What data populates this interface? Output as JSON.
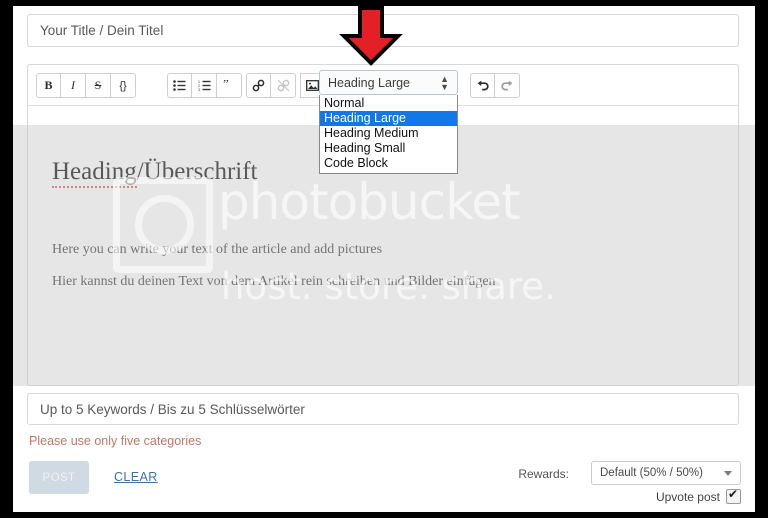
{
  "title_field": {
    "placeholder": "Your Title / Dein Titel",
    "value": ""
  },
  "toolbar": {
    "buttons": [
      {
        "name": "bold",
        "glyph": "B"
      },
      {
        "name": "italic",
        "glyph": "I"
      },
      {
        "name": "strikethrough",
        "glyph": "S"
      },
      {
        "name": "code",
        "glyph": "{}"
      },
      {
        "name": "bullet-list",
        "glyph": "☰"
      },
      {
        "name": "numbered-list",
        "glyph": "☲"
      },
      {
        "name": "blockquote",
        "glyph": "”"
      },
      {
        "name": "link",
        "glyph": "⚭"
      },
      {
        "name": "unlink",
        "glyph": "⚮"
      },
      {
        "name": "image",
        "glyph": "ὛC"
      },
      {
        "name": "undo",
        "glyph": "↶"
      },
      {
        "name": "redo",
        "glyph": "↷"
      }
    ],
    "format_select": {
      "selected": "Heading Large",
      "options": [
        "Normal",
        "Heading Large",
        "Heading Medium",
        "Heading Small",
        "Code Block"
      ],
      "highlight_color": "#1278e8"
    }
  },
  "editor": {
    "heading": "Heading/Überschrift",
    "heading_misspelled_part": "Heading",
    "heading_rest": "/Überschrift",
    "paragraphs": [
      "Here you can write your text of the article and add pictures",
      "Hier kannst du deinen Text von dem Artikel rein schreiben und Bilder einfügen"
    ]
  },
  "watermark": {
    "name": "photobucket",
    "tagline": "host. store. share.",
    "icon": "camera-icon"
  },
  "keywords_field": {
    "placeholder": "Up to 5 Keywords / Bis zu 5 Schlüsselwörter",
    "value": ""
  },
  "warning": {
    "text": "Please use only five categories",
    "color": "#c2766a"
  },
  "actions": {
    "post_label": "POST",
    "clear_label": "CLEAR"
  },
  "rewards": {
    "label": "Rewards:",
    "selected": "Default (50% / 50%)",
    "options": [
      "Default (50% / 50%)"
    ]
  },
  "upvote": {
    "label": "Upvote post",
    "checked": true
  },
  "annotation": {
    "type": "red-down-arrow",
    "color": "#e41f26",
    "points_at": "format-select"
  }
}
